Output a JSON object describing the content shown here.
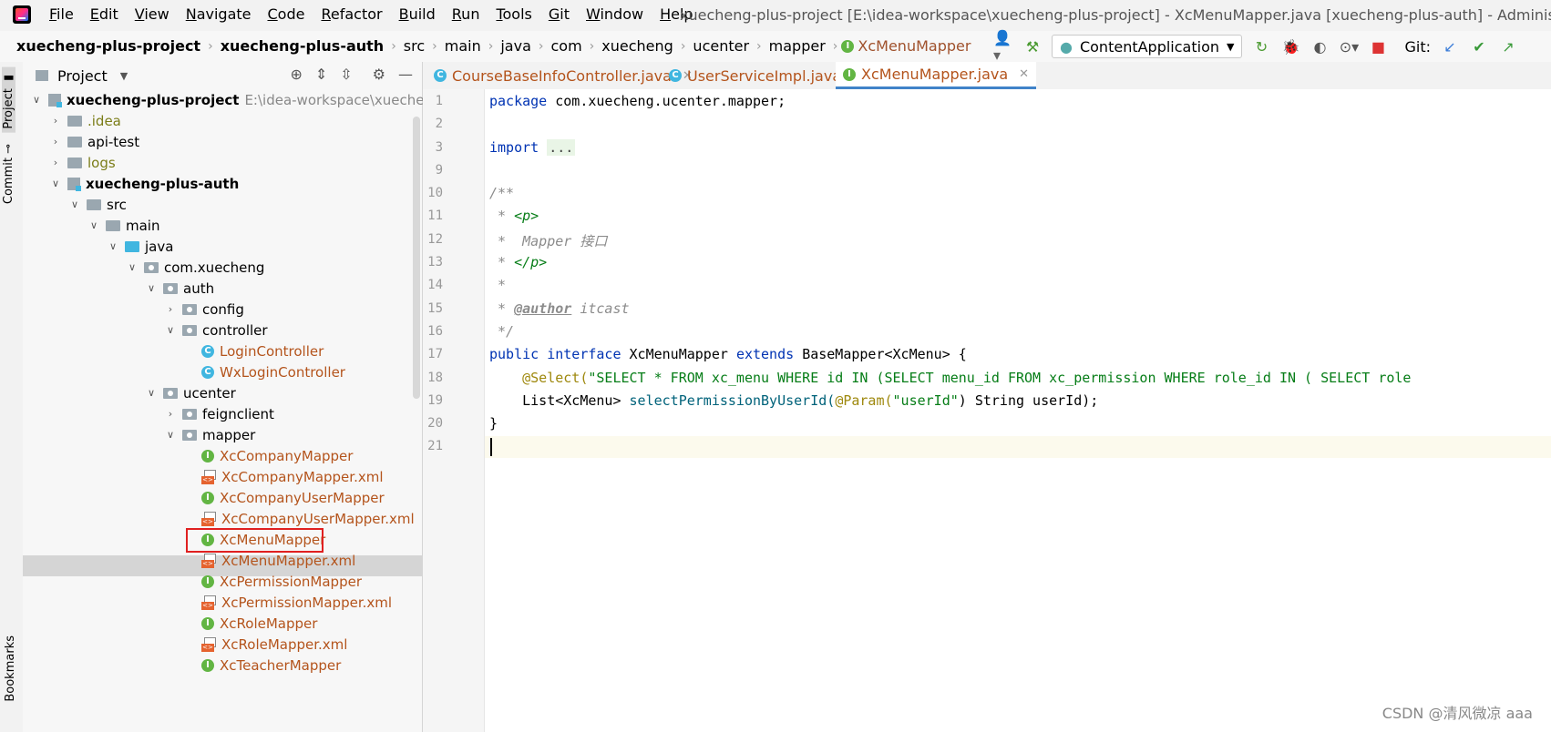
{
  "menubar": {
    "items": [
      "File",
      "Edit",
      "View",
      "Navigate",
      "Code",
      "Refactor",
      "Build",
      "Run",
      "Tools",
      "Git",
      "Window",
      "Help"
    ],
    "title": "xuecheng-plus-project [E:\\idea-workspace\\xuecheng-plus-project] - XcMenuMapper.java [xuecheng-plus-auth] - Administrator"
  },
  "breadcrumb": [
    "xuecheng-plus-project",
    "xuecheng-plus-auth",
    "src",
    "main",
    "java",
    "com",
    "xuecheng",
    "ucenter",
    "mapper",
    "XcMenuMapper"
  ],
  "toolbar": {
    "run_config": "ContentApplication",
    "git_label": "Git:"
  },
  "sidebar": {
    "project_tab": "Project",
    "commit_tab": "Commit",
    "bookmarks_tab": "Bookmarks"
  },
  "project": {
    "title": "Project",
    "root": {
      "name": "xuecheng-plus-project",
      "path": "E:\\idea-workspace\\xuecheng-plu"
    },
    "nodes": [
      ".idea",
      "api-test",
      "logs",
      "xuecheng-plus-auth",
      "src",
      "main",
      "java",
      "com.xuecheng",
      "auth",
      "config",
      "controller",
      "LoginController",
      "WxLoginController",
      "ucenter",
      "feignclient",
      "mapper",
      "XcCompanyMapper",
      "XcCompanyMapper.xml",
      "XcCompanyUserMapper",
      "XcCompanyUserMapper.xml",
      "XcMenuMapper",
      "XcMenuMapper.xml",
      "XcPermissionMapper",
      "XcPermissionMapper.xml",
      "XcRoleMapper",
      "XcRoleMapper.xml",
      "XcTeacherMapper"
    ]
  },
  "editor": {
    "tabs": [
      {
        "label": "CourseBaseInfoController.java",
        "icon": "C"
      },
      {
        "label": "UserServiceImpl.java",
        "icon": "C"
      },
      {
        "label": "XcMenuMapper.java",
        "icon": "I"
      }
    ],
    "line_numbers": [
      "1",
      "2",
      "3",
      "9",
      "10",
      "11",
      "12",
      "13",
      "14",
      "15",
      "16",
      "17",
      "18",
      "19",
      "20",
      "21"
    ],
    "code": {
      "l1a": "package ",
      "l1b": "com.xuecheng.ucenter.mapper;",
      "l3a": "import ",
      "l3b": "...",
      "l10": "/**",
      "l11a": " * ",
      "l11b": "<p>",
      "l12": " *  Mapper 接口",
      "l13a": " * ",
      "l13b": "</p>",
      "l14": " *",
      "l15a": " * ",
      "l15b": "@author",
      "l15c": " itcast",
      "l16": " */",
      "l17a": "public interface ",
      "l17b": "XcMenuMapper ",
      "l17c": "extends ",
      "l17d": "BaseMapper<XcMenu> {",
      "l18a": "    @Select(",
      "l18b": "\"SELECT * FROM xc_menu WHERE id IN (SELECT menu_id FROM xc_permission WHERE role_id IN ( SELECT role",
      "l19a": "    List<XcMenu> ",
      "l19b": "selectPermissionByUserId(",
      "l19c": "@Param(",
      "l19d": "\"userId\"",
      "l19e": ") String userId);",
      "l20": "}"
    }
  },
  "watermark": "CSDN @清风微凉 aaa"
}
